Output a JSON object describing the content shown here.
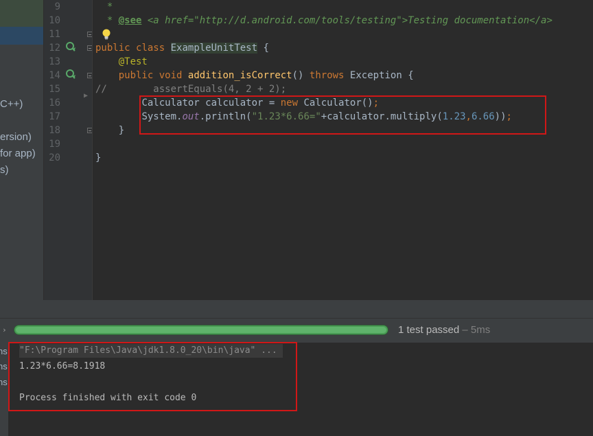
{
  "project_panel": {
    "fragments": [
      "C++)",
      "ersion)",
      "for app)",
      "s)"
    ]
  },
  "editor": {
    "line_numbers": [
      "9",
      "10",
      "11",
      "12",
      "13",
      "14",
      "15",
      "16",
      "17",
      "18",
      "19",
      "20"
    ],
    "line9": "*",
    "line10": {
      "star": "* ",
      "see_tag": "@see",
      "link": " <a href=\"http://d.android.com/tools/testing\">Testing documentation</a>"
    },
    "line12": {
      "kw_public": "public",
      "kw_class": "class",
      "class_name": "ExampleUnitTest",
      "brace": "{"
    },
    "line13": {
      "annotation": "@Test"
    },
    "line14": {
      "kw_public": "public",
      "kw_void": "void",
      "method": "addition_isCorrect",
      "parens": "()",
      "kw_throws": "throws",
      "exception": "Exception {"
    },
    "line15": {
      "comment_marker": "//",
      "code": "assertEquals(4, 2 + 2);"
    },
    "line16": {
      "part1": "Calculator calculator = ",
      "kw_new": "new",
      "part2": " Calculator()",
      "semi": ";"
    },
    "line17": {
      "system": "System.",
      "out": "out",
      "println": ".println(",
      "str": "\"1.23*6.66=\"",
      "plus": "+calculator.multiply(",
      "n1": "1.23",
      "comma": ",",
      "n2": "6.66",
      "close": "))",
      "semi": ";"
    },
    "line18": "}",
    "line20": "}"
  },
  "run_panel": {
    "progress_percent": 100,
    "status_text": "1 test passed",
    "duration": " – 5ms"
  },
  "console": {
    "left_fragments": [
      "ns",
      "ns",
      "ns"
    ],
    "command": "\"F:\\Program Files\\Java\\jdk1.8.0_20\\bin\\java\" ...",
    "output": "1.23*6.66=8.1918",
    "exit": "Process finished with exit code 0"
  },
  "colors": {
    "highlight_box": "#d11717",
    "progress_green": "#5fb36b"
  }
}
